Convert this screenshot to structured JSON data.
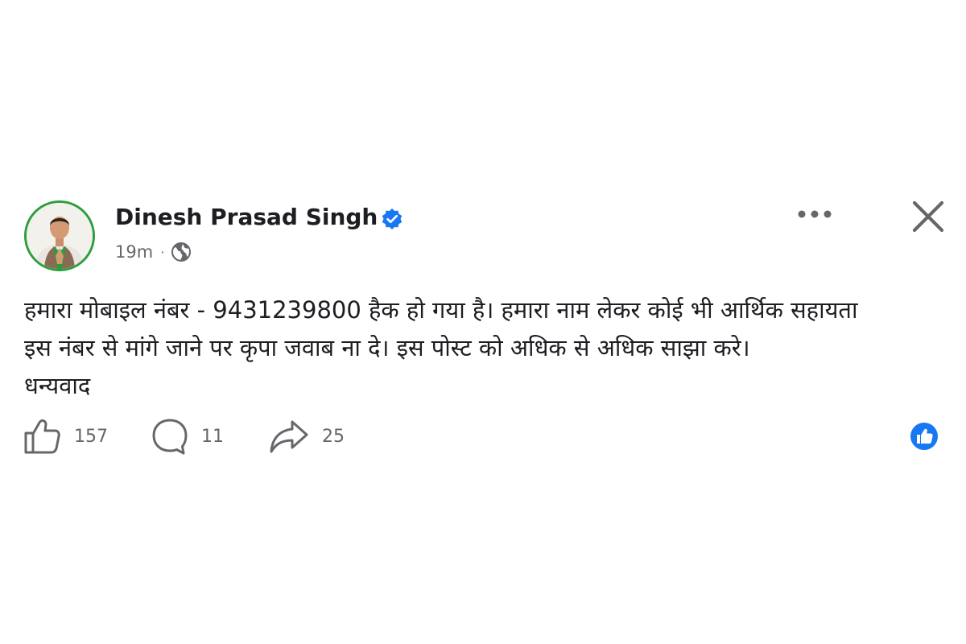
{
  "post": {
    "author": {
      "name": "Dinesh Prasad Singh",
      "verified": true,
      "avatar_border_color": "#2e9e3c"
    },
    "timestamp": "19m",
    "audience_icon": "globe-icon",
    "body_lines": [
      "हमारा मोबाइल नंबर - 9431239800 हैक हो गया है। हमारा नाम लेकर कोई भी आर्थिक सहायता",
      "इस नंबर से मांगे जाने पर कृपा जवाब ना दे। इस पोस्ट को अधिक से अधिक साझा करे।",
      "धन्यवाद"
    ],
    "actions": {
      "like_count": "157",
      "comment_count": "11",
      "share_count": "25"
    },
    "reaction_icon": "like-reaction-icon",
    "colors": {
      "verified_blue": "#1877f2",
      "secondary_text": "#65676b",
      "primary_text": "#1c1e21"
    }
  }
}
